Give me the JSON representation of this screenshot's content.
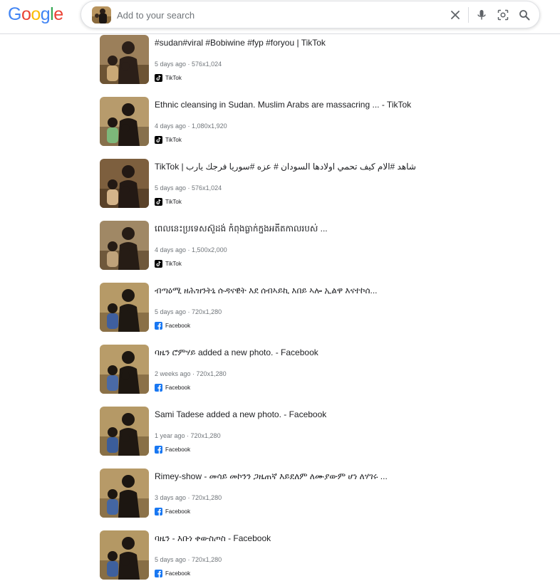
{
  "logo": {
    "letters": [
      "G",
      "o",
      "o",
      "g",
      "l",
      "e"
    ],
    "colors": [
      "#4285F4",
      "#EA4335",
      "#FBBC05",
      "#4285F4",
      "#34A853",
      "#EA4335"
    ]
  },
  "search": {
    "placeholder": "Add to your search",
    "value": ""
  },
  "icons": {
    "clear": "close-icon",
    "voice": "microphone-icon",
    "lens": "lens-icon",
    "search": "search-icon"
  },
  "brand_colors": {
    "tiktok": "#000000",
    "facebook": "#1877F2"
  },
  "results": [
    {
      "title": "#sudan#viral #Bobiwine #fyp #foryou | TikTok",
      "age": "5 days ago",
      "size": "576x1,024",
      "source": "TikTok",
      "source_icon": "tiktok-icon"
    },
    {
      "title": "Ethnic cleansing in Sudan. Muslim Arabs are massacring ... - TikTok",
      "age": "4 days ago",
      "size": "1,080x1,920",
      "source": "TikTok",
      "source_icon": "tiktok-icon"
    },
    {
      "title": "TikTok | شاهد #الام كيف تحمي اولادها السودان # عزه #سوريا فرجك يارب",
      "age": "5 days ago",
      "size": "576x1,024",
      "source": "TikTok",
      "source_icon": "tiktok-icon"
    },
    {
      "title": "ពេលនេះប្រទេសស៊ូដង់ កំពុងធ្លាក់ក្នុងអតីតកាលរបស់ ...",
      "age": "4 days ago",
      "size": "1,500x2,000",
      "source": "TikTok",
      "source_icon": "tiktok-icon"
    },
    {
      "title": "ብጣዕሚ ዘሕዝንትኒ ሱዳናዊት እደ ሰብኣይኪ እበይ ኣሎ ኢልዋ እናተኮሰ...",
      "age": "5 days ago",
      "size": "720x1,280",
      "source": "Facebook",
      "source_icon": "facebook-icon"
    },
    {
      "title": "ባዜን ሮምሃይ added a new photo. - Facebook",
      "age": "2 weeks ago",
      "size": "720x1,280",
      "source": "Facebook",
      "source_icon": "facebook-icon"
    },
    {
      "title": "Sami Tadese added a new photo. - Facebook",
      "age": "1 year ago",
      "size": "720x1,280",
      "source": "Facebook",
      "source_icon": "facebook-icon"
    },
    {
      "title": "Rimey-show - መሳይ መኮንን ጋዜጠኛ እይደለም ለሙያውም ሆነ ለሃገሩ ...",
      "age": "3 days ago",
      "size": "720x1,280",
      "source": "Facebook",
      "source_icon": "facebook-icon"
    },
    {
      "title": "ባዜን - እቡነ ቀውስጦስ - Facebook",
      "age": "5 days ago",
      "size": "720x1,280",
      "source": "Facebook",
      "source_icon": "facebook-icon"
    }
  ]
}
